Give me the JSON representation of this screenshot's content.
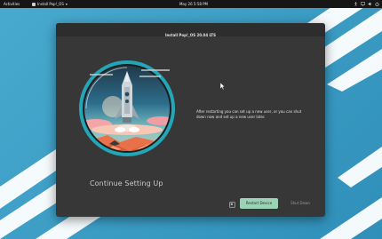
{
  "topbar": {
    "activities": "Activities",
    "app_menu_label": "Install Pop!_OS",
    "clock": "May 26  5:58 PM",
    "tray_icons": [
      "accessibility-icon",
      "network-icon",
      "volume-icon",
      "power-icon"
    ]
  },
  "window": {
    "title": "Install Pop!_OS 20.04 LTS",
    "message": "After restarting you can set up a new user, or you can shut down now and set up a new user later.",
    "heading": "Continue Setting Up",
    "buttons": {
      "restart": "Restart Device",
      "shutdown": "Shut Down"
    }
  },
  "colors": {
    "accent": "#9bd3b6",
    "window_bg": "#373737",
    "titlebar_bg": "#2d2d2d",
    "desktop_bg": "#3b9ec7",
    "topbar_bg": "#161616"
  },
  "illustration": {
    "name": "rocket-launch-illustration"
  }
}
